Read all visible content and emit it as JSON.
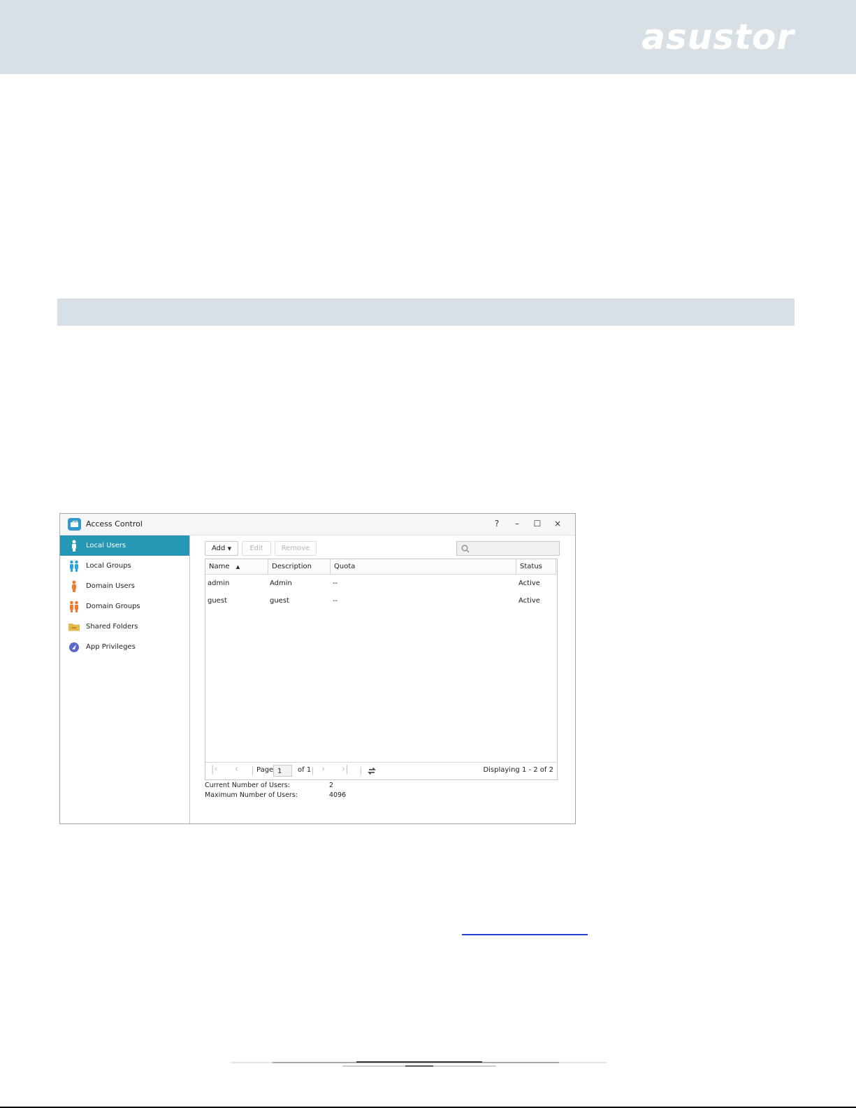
{
  "header": {
    "logo": "asustor"
  },
  "window": {
    "title": "Access Control",
    "controls": {
      "help": "?",
      "minimize": "–",
      "maximize": "☐",
      "close": "×"
    },
    "sidebar": {
      "items": [
        {
          "label": "Local Users",
          "icon": "user-icon",
          "color": "#ffffff",
          "active": true
        },
        {
          "label": "Local Groups",
          "icon": "group-icon",
          "color": "#2aa6d8",
          "active": false
        },
        {
          "label": "Domain Users",
          "icon": "domain-user-icon",
          "color": "#f07a2e",
          "active": false
        },
        {
          "label": "Domain Groups",
          "icon": "domain-group-icon",
          "color": "#f07a2e",
          "active": false
        },
        {
          "label": "Shared Folders",
          "icon": "folder-icon",
          "color": "#e6b84a",
          "active": false
        },
        {
          "label": "App Privileges",
          "icon": "app-privileges-icon",
          "color": "#5b67c9",
          "active": false
        }
      ]
    },
    "toolbar": {
      "add": "Add",
      "edit": "Edit",
      "remove": "Remove",
      "search_placeholder": ""
    },
    "table": {
      "columns": [
        "Name",
        "Description",
        "Quota",
        "Status"
      ],
      "rows": [
        {
          "name": "admin",
          "description": "Admin",
          "quota": "--",
          "status": "Active"
        },
        {
          "name": "guest",
          "description": "guest",
          "quota": "--",
          "status": "Active"
        }
      ]
    },
    "pager": {
      "page_label": "Page",
      "page": "1",
      "of": "of 1",
      "displaying": "Displaying 1 - 2 of 2"
    },
    "summary": {
      "current_label": "Current Number of Users:",
      "current_value": "2",
      "max_label": "Maximum Number of Users:",
      "max_value": "4096"
    }
  },
  "colors": {
    "accent": "#2697b5",
    "header_bg": "#d8e0e5",
    "link": "#2b40d8"
  }
}
